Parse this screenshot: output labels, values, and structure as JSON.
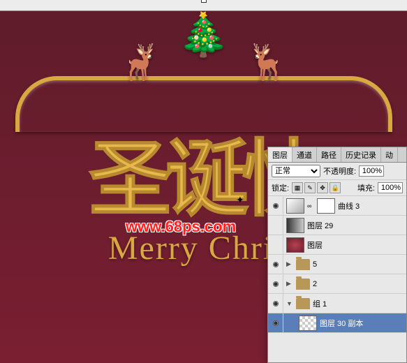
{
  "canvas": {
    "chinese_text": "圣诞快",
    "english_text": "Merry Christ",
    "watermark": "www.68ps.com"
  },
  "panel": {
    "tabs": {
      "layers": "图层",
      "channels": "通道",
      "paths": "路径",
      "history": "历史记录",
      "actions": "动"
    },
    "blend_mode": "正常",
    "opacity_label": "不透明度:",
    "opacity_value": "100%",
    "lock_label": "锁定:",
    "fill_label": "填充:",
    "fill_value": "100%",
    "layers": [
      {
        "name": "曲线 3",
        "type": "adjustment"
      },
      {
        "name": "图层 29",
        "type": "layer"
      },
      {
        "name": "图层",
        "type": "layer"
      },
      {
        "name": "5",
        "type": "group"
      },
      {
        "name": "2",
        "type": "group"
      },
      {
        "name": "组 1",
        "type": "group",
        "expanded": true
      },
      {
        "name": "图层 30 副本",
        "type": "layer",
        "selected": true
      }
    ]
  }
}
